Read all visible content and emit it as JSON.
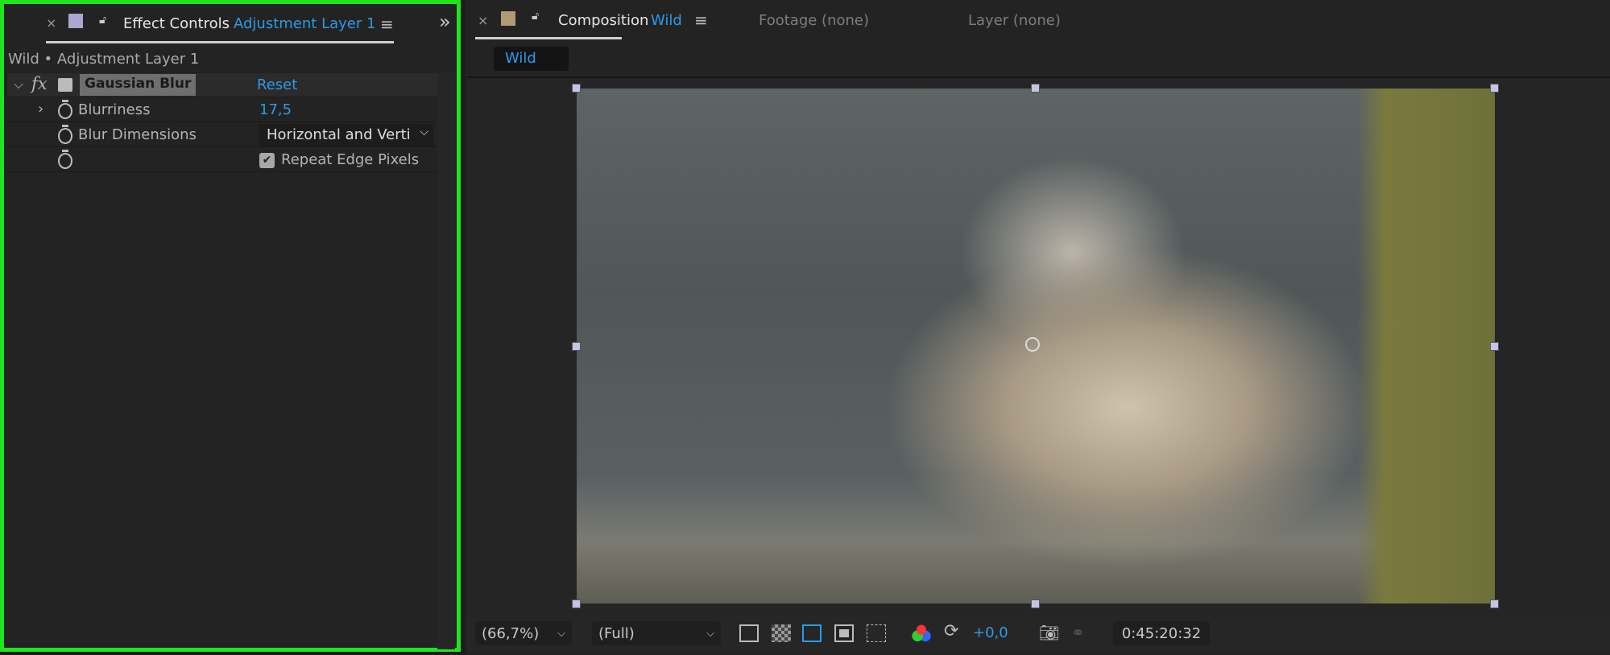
{
  "effect_panel": {
    "tab_close": "×",
    "tab_title": "Effect Controls",
    "tab_layer": "Adjustment Layer 1",
    "menu": "≡",
    "overflow": "»",
    "breadcrumb": "Wild • Adjustment Layer 1",
    "effect": {
      "fx": "fx",
      "name": "Gaussian Blur",
      "reset": "Reset"
    },
    "props": [
      {
        "label": "Blurriness",
        "value": "17,5"
      },
      {
        "label": "Blur Dimensions",
        "value": "Horizontal and Verti"
      },
      {
        "label": "",
        "value": "Repeat Edge Pixels",
        "checked": true
      }
    ]
  },
  "comp_panel": {
    "tab_close": "×",
    "tab_title": "Composition",
    "tab_comp": "Wild",
    "menu": "≡",
    "footage_tab": "Footage (none)",
    "layer_tab": "Layer (none)",
    "comp_button": "Wild",
    "label_color": "#b09a76"
  },
  "toolbar": {
    "zoom": "(66,7%)",
    "resolution": "(Full)",
    "exposure": "+0,0",
    "timecode": "0:45:20:32"
  },
  "colors": {
    "accent": "#2d9ae8",
    "highlight": "#1fe51f"
  }
}
